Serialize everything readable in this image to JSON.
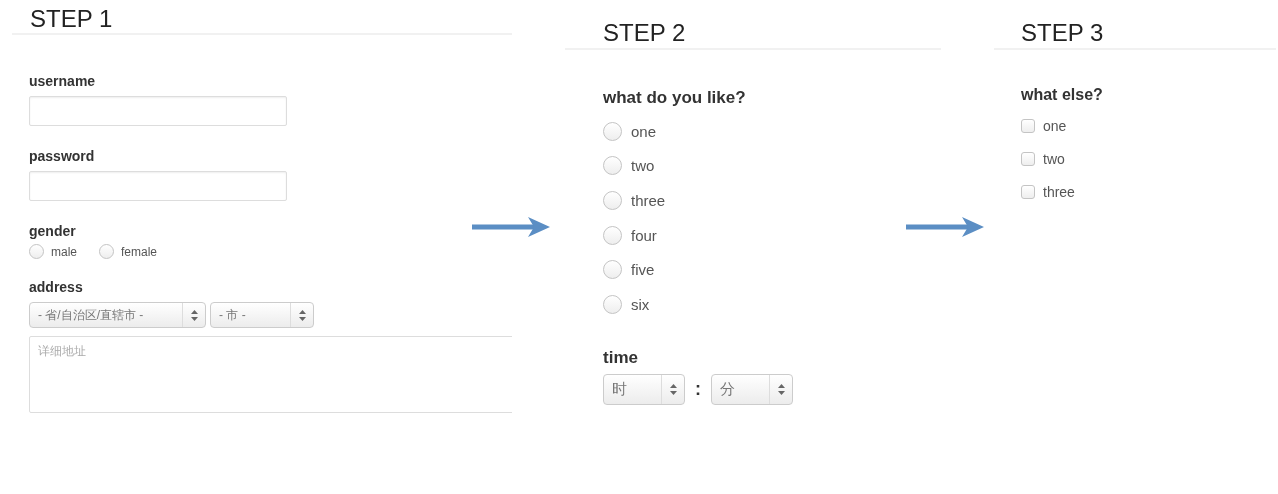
{
  "steps": [
    {
      "title": "STEP 1",
      "fields": [
        {
          "kind": "text",
          "label": "username"
        },
        {
          "kind": "text",
          "label": "password"
        },
        {
          "kind": "radio-inline",
          "label": "gender",
          "options": [
            {
              "label": "male",
              "selected": false
            },
            {
              "label": "female",
              "selected": false
            }
          ]
        },
        {
          "kind": "address",
          "label": "address",
          "selects": [
            "- 省/自治区/直辖市 -",
            "- 市 -"
          ],
          "placeholder": "详细地址"
        }
      ]
    },
    {
      "title": "STEP 2",
      "fields": [
        {
          "kind": "radio-list",
          "label": "what do you like?",
          "options": [
            {
              "label": "one",
              "selected": false
            },
            {
              "label": "two",
              "selected": false
            },
            {
              "label": "three",
              "selected": false
            },
            {
              "label": "four",
              "selected": false
            },
            {
              "label": "five",
              "selected": false
            },
            {
              "label": "six",
              "selected": false
            }
          ]
        },
        {
          "kind": "time",
          "label": "time",
          "selects": [
            "时",
            "分"
          ],
          "separator": ":"
        }
      ]
    },
    {
      "title": "STEP 3",
      "fields": [
        {
          "kind": "checkbox-list",
          "label": "what else?",
          "options": [
            {
              "label": "one",
              "checked": false
            },
            {
              "label": "two",
              "checked": false
            },
            {
              "label": "three",
              "checked": false
            }
          ]
        }
      ]
    }
  ]
}
